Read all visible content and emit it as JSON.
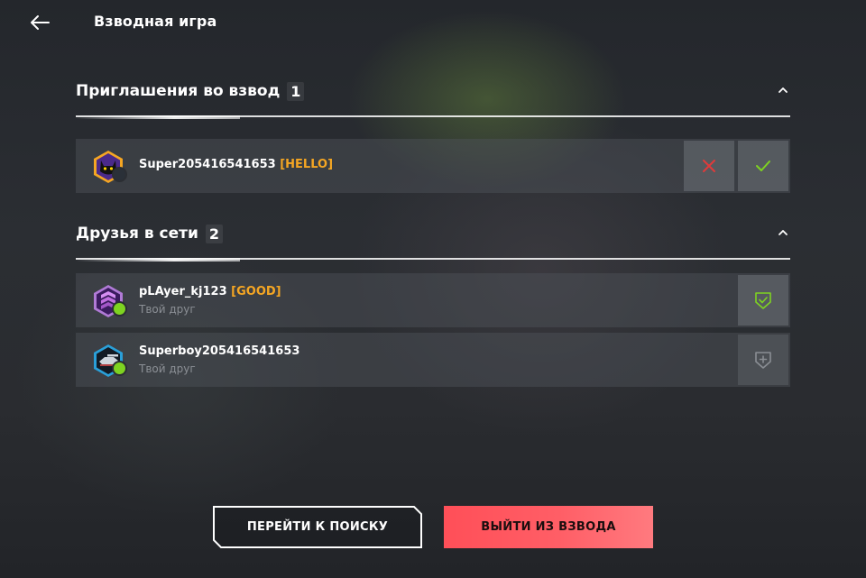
{
  "header": {
    "title": "Взводная игра",
    "back_icon": "arrow-left-icon"
  },
  "invites": {
    "title": "Приглашения во взвод",
    "count": "1",
    "items": [
      {
        "name": "Super205416541653",
        "clan": "[HELLO]",
        "status": "offline",
        "avatar_icon": "black-cat-avatar-icon",
        "decline_icon": "close-icon",
        "accept_icon": "check-icon"
      }
    ]
  },
  "friends": {
    "title": "Друзья в сети",
    "count": "2",
    "items": [
      {
        "name": "pLAyer_kj123",
        "clan": "[GOOD]",
        "subtitle": "Твой друг",
        "status": "online",
        "avatar_icon": "purple-rank-avatar-icon",
        "action_icon": "shield-check-icon"
      },
      {
        "name": "Superboy205416541653",
        "clan": "",
        "subtitle": "Твой друг",
        "status": "online",
        "avatar_icon": "blue-tank-avatar-icon",
        "action_icon": "shield-plus-icon"
      }
    ]
  },
  "footer": {
    "search_label": "ПЕРЕЙТИ К ПОИСКУ",
    "leave_label": "ВЫЙТИ ИЗ ВЗВОДА"
  },
  "colors": {
    "accent_orange": "#f5a623",
    "danger": "#ff5e66",
    "online": "#7ed321",
    "decline": "#e03a3a",
    "accept": "#7ed321"
  }
}
